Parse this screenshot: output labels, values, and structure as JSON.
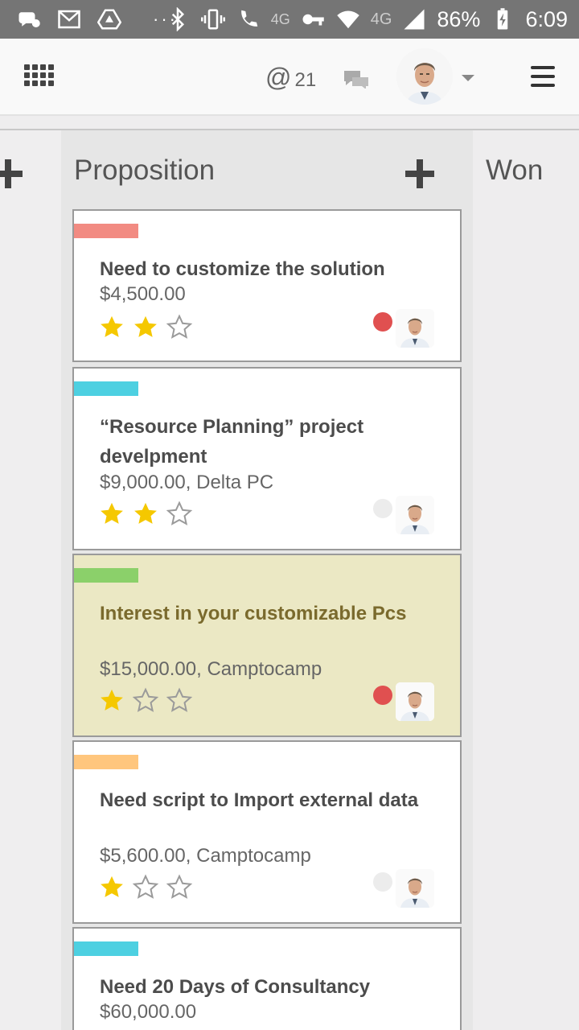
{
  "status_bar": {
    "network": "4G",
    "network_small": "4G",
    "battery": "86%",
    "time": "6:09",
    "icons": [
      "chat-bubble-icon",
      "gmail-icon",
      "drive-icon",
      "more-dots-icon",
      "bluetooth-icon",
      "vibrate-icon",
      "volte-call-icon",
      "key-icon",
      "wifi-icon",
      "signal-icon",
      "battery-charging-icon"
    ]
  },
  "header": {
    "mention_symbol": "@",
    "mention_count": "21",
    "icons": [
      "apps-grid-icon",
      "chat-icon",
      "avatar",
      "dropdown-caret-icon",
      "hamburger-menu-icon"
    ]
  },
  "columns": {
    "left": {
      "title": ""
    },
    "main": {
      "title": "Proposition"
    },
    "right": {
      "title": "Won"
    }
  },
  "cards": [
    {
      "title": "Need to customize the solution",
      "amount": "$4,500.00",
      "stars": 2,
      "tag_color": "#f28b82",
      "status": "red",
      "highlight": false
    },
    {
      "title": "“Resource Planning” project develpment",
      "amount": "$9,000.00, Delta PC",
      "stars": 2,
      "tag_color": "#4dd0e1",
      "status": "grey",
      "highlight": false
    },
    {
      "title": "Interest in your customizable Pcs",
      "amount": "$15,000.00, Camptocamp",
      "stars": 1,
      "tag_color": "#8bd06a",
      "status": "red",
      "highlight": true
    },
    {
      "title": "Need script to Import external data",
      "amount": "$5,600.00, Camptocamp",
      "stars": 1,
      "tag_color": "#ffc67d",
      "status": "grey",
      "highlight": false
    },
    {
      "title": "Need 20 Days of Consultancy",
      "amount": "$60,000.00",
      "stars": 0,
      "tag_color": "#4dd0e1",
      "status": "none",
      "highlight": false
    }
  ],
  "colors": {
    "status_red": "#e05050",
    "status_grey": "#ececec",
    "star_filled": "#f5c800",
    "star_empty": "#9a9a9a"
  }
}
